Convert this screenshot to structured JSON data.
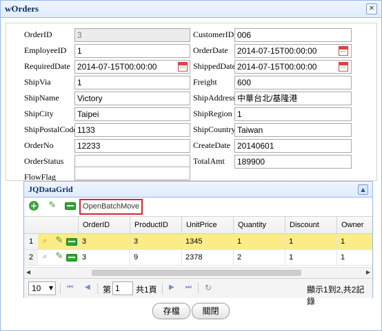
{
  "window": {
    "title": "wOrders"
  },
  "form": {
    "orderid": {
      "label": "OrderID",
      "value": "3"
    },
    "customerid": {
      "label": "CustomerID",
      "value": "006"
    },
    "employeeid": {
      "label": "EmployeeID",
      "value": "1"
    },
    "orderdate": {
      "label": "OrderDate",
      "value": "2014-07-15T00:00:00"
    },
    "requireddate": {
      "label": "RequiredDate",
      "value": "2014-07-15T00:00:00"
    },
    "shippeddate": {
      "label": "ShippedDate",
      "value": "2014-07-15T00:00:00"
    },
    "shipvia": {
      "label": "ShipVia",
      "value": "1"
    },
    "freight": {
      "label": "Freight",
      "value": "600"
    },
    "shipname": {
      "label": "ShipName",
      "value": "Victory"
    },
    "shipaddress": {
      "label": "ShipAddress",
      "value": "中華台北/基隆港"
    },
    "shipcity": {
      "label": "ShipCity",
      "value": "Taipei"
    },
    "shipregion": {
      "label": "ShipRegion",
      "value": "1"
    },
    "shippostalcode": {
      "label": "ShipPostalCode",
      "value": "1133"
    },
    "shipcountry": {
      "label": "ShipCountry",
      "value": "Taiwan"
    },
    "orderno": {
      "label": "OrderNo",
      "value": "12233"
    },
    "createdate": {
      "label": "CreateDate",
      "value": "20140601"
    },
    "orderstatus": {
      "label": "OrderStatus",
      "value": ""
    },
    "totalamt": {
      "label": "TotalAmt",
      "value": "189900"
    },
    "flowflag": {
      "label": "FlowFlag",
      "value": ""
    }
  },
  "grid": {
    "title": "JQDataGrid",
    "batch_button": "OpenBatchMove",
    "columns": [
      "OrderID",
      "ProductID",
      "UnitPrice",
      "Quantity",
      "Discount",
      "Owner"
    ],
    "rows": [
      {
        "num": "1",
        "cells": [
          "3",
          "3",
          "1345",
          "1",
          "1",
          "1"
        ],
        "selected": true
      },
      {
        "num": "2",
        "cells": [
          "3",
          "9",
          "2378",
          "2",
          "1",
          "1"
        ],
        "selected": false
      }
    ],
    "pager": {
      "page_size": "10",
      "page_prefix": "第",
      "page_value": "1",
      "page_suffix": "共1頁",
      "summary": "顯示1到2,共2記錄"
    }
  },
  "buttons": {
    "save": "存檔",
    "close": "關閉"
  },
  "colors": {
    "accent_border": "#95b8e7",
    "highlight_row": "#fbec88",
    "batch_outline": "#d9232d"
  }
}
